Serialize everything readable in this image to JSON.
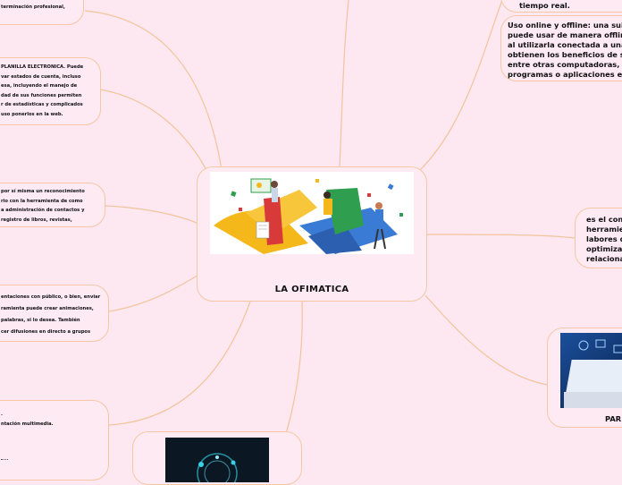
{
  "central": {
    "title": "LA OFIMATICA"
  },
  "top_left": {
    "lines": [
      "terminación profesional,"
    ]
  },
  "spreadsheet": {
    "lines": [
      "PLANILLA ELECTRONICA.  Puede",
      "var estados de cuenta, incluso",
      "esa, incluyendo el manejo de",
      "dad de sus funciones permiten",
      "r de estadísticas y complicados",
      "uso ponerlos en la web."
    ]
  },
  "database": {
    "lines": [
      "por sí misma un reconocimiento",
      "rio con la herramienta de como",
      "a administración de contactos y",
      "registro de libros, revistas,"
    ]
  },
  "presentation": {
    "lines": [
      "entaciones con público, o bien, enviar",
      "ramienta puede crear  animaciones,",
      "palabras, si lo desea. También",
      "cer difusiones en directo a grupos"
    ]
  },
  "bottom_left": {
    "lines": [
      ".",
      "ntación multimedia."
    ]
  },
  "top_right_partial": {
    "lines": [
      "tiempo real."
    ]
  },
  "online_offline": {
    "lines": [
      "Uso online y offline: una suite",
      "puede usar de manera offline",
      "al utilizarla conectada a una",
      "obtienen los beneficios de sin",
      "entre otras computadoras, us",
      "programas o aplicaciones en"
    ]
  },
  "definition": {
    "lines": [
      "es el conju",
      "herramien",
      "labores de",
      "optimizac",
      "relacionad"
    ]
  },
  "para": {
    "title": "PAR"
  },
  "colors": {
    "background": "#fde8f1",
    "node_border": "#f5c7a4",
    "link": "#f2c49b"
  }
}
